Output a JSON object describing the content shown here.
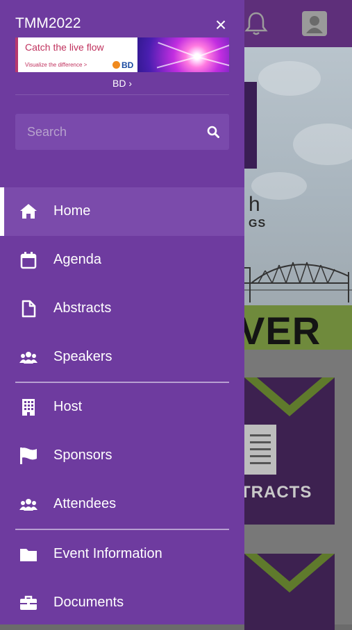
{
  "drawer": {
    "title": "TMM2022",
    "close_symbol": "×",
    "ad": {
      "headline": "Catch the live flow",
      "subline": "Visualize the difference >",
      "brand": "BD"
    },
    "ad_link": "BD ›",
    "search": {
      "placeholder": "Search",
      "value": ""
    },
    "menu": [
      {
        "label": "Home",
        "icon": "home-icon",
        "active": true
      },
      {
        "label": "Agenda",
        "icon": "calendar-icon"
      },
      {
        "label": "Abstracts",
        "icon": "document-icon"
      },
      {
        "label": "Speakers",
        "icon": "users-icon"
      },
      {
        "label": "Host",
        "icon": "building-icon"
      },
      {
        "label": "Sponsors",
        "icon": "flag-icon"
      },
      {
        "label": "Attendees",
        "icon": "users-icon"
      },
      {
        "label": "Event Information",
        "icon": "folder-icon"
      },
      {
        "label": "Documents",
        "icon": "briefcase-icon"
      }
    ]
  },
  "background": {
    "hero_text": "h",
    "hero_subtext": "GS",
    "banner_text": "VER",
    "tile_label": "TRACTS"
  },
  "colors": {
    "drawer": "#6e3b9f",
    "active_item": "#7b4bab",
    "accent_green": "#6f8a3c",
    "ad_text": "#c0325e"
  }
}
